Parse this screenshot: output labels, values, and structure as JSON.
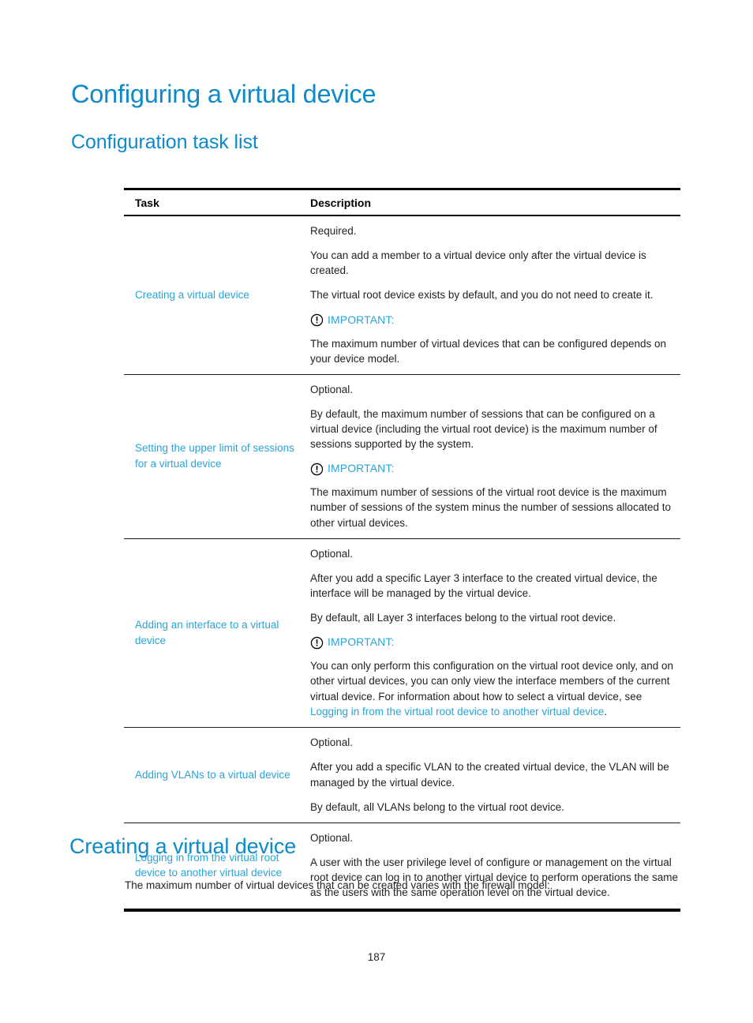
{
  "document": {
    "title": "Configuring a virtual device",
    "section_heading": "Configuration task list",
    "bottom_heading": "Creating a virtual device",
    "bottom_paragraph": "The maximum number of virtual devices that can be created varies with the firewall model:",
    "page_number": "187"
  },
  "colors": {
    "heading_blue": "#0d8ac8",
    "link_blue": "#2aa4d8",
    "body_text": "#231f20",
    "rule_black": "#000000"
  },
  "table": {
    "headers": {
      "task": "Task",
      "description": "Description"
    },
    "rows": [
      {
        "task_link": "Creating a virtual device",
        "paragraphs": [
          "Required.",
          "You can add a member to a virtual device only after the virtual device is created.",
          "The virtual root device exists by default, and you do not need to create it."
        ],
        "important": {
          "icon": "exclamation-circle-icon",
          "label": "IMPORTANT:",
          "text": "The maximum number of virtual devices that can be configured depends on your device model."
        }
      },
      {
        "task_link": "Setting the upper limit of sessions for a virtual device",
        "paragraphs": [
          "Optional.",
          "By default, the maximum number of sessions that can be configured on a virtual device (including the virtual root device) is the maximum number of sessions supported by the system."
        ],
        "important": {
          "icon": "exclamation-circle-icon",
          "label": "IMPORTANT:",
          "text": "The maximum number of sessions of the virtual root device is the maximum number of sessions of the system minus the number of sessions allocated to other virtual devices."
        }
      },
      {
        "task_link": "Adding an interface to a virtual device",
        "paragraphs": [
          "Optional.",
          "After you add a specific Layer 3 interface to the created virtual device, the interface will be managed by the virtual device.",
          "By default, all Layer 3 interfaces belong to the virtual root device."
        ],
        "important": {
          "icon": "exclamation-circle-icon",
          "label": "IMPORTANT:",
          "text_before": "You can only perform this configuration on the virtual root device only, and on other virtual devices, you can only view the interface members of the current virtual device. For information about how to select a virtual device, see ",
          "text_link": "Logging in from the virtual root device to another virtual device",
          "text_after": "."
        }
      },
      {
        "task_link": "Adding VLANs to a virtual device",
        "paragraphs": [
          "Optional.",
          "After you add a specific VLAN to the created virtual device, the VLAN will be managed by the virtual device.",
          "By default, all VLANs belong to the virtual root device."
        ]
      },
      {
        "task_link": "Logging in from the virtual root device to another virtual device",
        "paragraphs": [
          "Optional.",
          "A user with the user privilege level of configure or management on the virtual root device can log in to another virtual device to perform operations the same as the users with the same operation level on the virtual device."
        ]
      }
    ]
  }
}
